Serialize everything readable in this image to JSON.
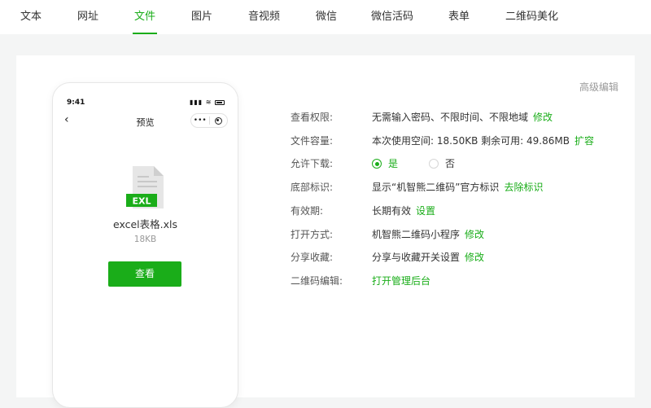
{
  "tabs": [
    {
      "label": "文本"
    },
    {
      "label": "网址"
    },
    {
      "label": "文件"
    },
    {
      "label": "图片"
    },
    {
      "label": "音视频"
    },
    {
      "label": "微信"
    },
    {
      "label": "微信活码"
    },
    {
      "label": "表单"
    },
    {
      "label": "二维码美化"
    }
  ],
  "active_tab": "文件",
  "advanced_edit": "高级编辑",
  "phone": {
    "time": "9:41",
    "title": "预览",
    "capsule_dots": "•••",
    "file_badge": "EXL",
    "file_name": "excel表格.xls",
    "file_size": "18KB",
    "view_button": "查看"
  },
  "settings": {
    "view_permission": {
      "label": "查看权限:",
      "value": "无需输入密码、不限时间、不限地域",
      "link": "修改"
    },
    "capacity": {
      "label": "文件容量:",
      "value": "本次使用空间: 18.50KB 剩余可用: 49.86MB",
      "link": "扩容"
    },
    "download": {
      "label": "允许下载:",
      "yes": "是",
      "no": "否",
      "selected": "是"
    },
    "footer_mark": {
      "label": "底部标识:",
      "value": "显示“机智熊二维码”官方标识",
      "link": "去除标识"
    },
    "validity": {
      "label": "有效期:",
      "value": "长期有效",
      "link": "设置"
    },
    "open_mode": {
      "label": "打开方式:",
      "value": "机智熊二维码小程序",
      "link": "修改"
    },
    "share": {
      "label": "分享收藏:",
      "value": "分享与收藏开关设置",
      "link": "修改"
    },
    "qr_edit": {
      "label": "二维码编辑:",
      "link": "打开管理后台"
    }
  },
  "colors": {
    "accent": "#1aad19",
    "file_icon": "#e3e3e3",
    "badge": "#1aad19"
  }
}
